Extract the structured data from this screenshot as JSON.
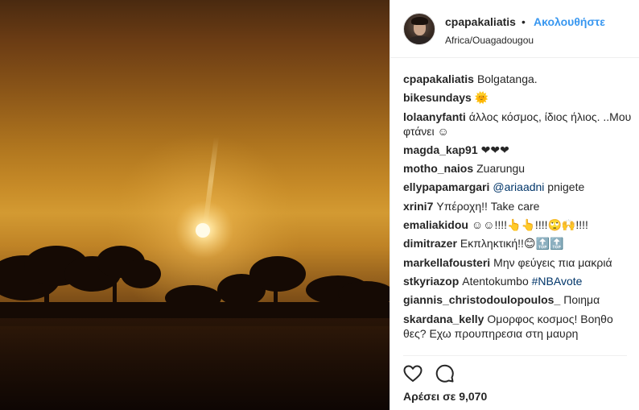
{
  "post": {
    "username": "cpapakaliatis",
    "separator": "•",
    "follow_label": "Ακολουθήστε",
    "location": "Africa/Ouagadougou"
  },
  "comments": [
    {
      "user": "cpapakaliatis",
      "text": "Bolgatanga."
    },
    {
      "user": "bikesundays",
      "text": "🌞"
    },
    {
      "user": "lolaanyfanti",
      "text": "άλλος κόσμος, ίδιος ήλιος. ..Μου φτάνει ☺"
    },
    {
      "user": "magda_kap91",
      "text": "❤❤❤"
    },
    {
      "user": "motho_naios",
      "text": "Zuarungu"
    },
    {
      "user": "ellypapamargari",
      "text": "",
      "mention": "@ariaadni",
      "after": " pnigete"
    },
    {
      "user": "xrini7",
      "text": "Υπέροχη!! Take care"
    },
    {
      "user": "emaliakidou",
      "text": "☺☺!!!!👆👆!!!!🙄🙌!!!!"
    },
    {
      "user": "dimitrazer",
      "text": "Εκπληκτική!!😊🔝🔝"
    },
    {
      "user": "markellafousteri",
      "text": "Μην φεύγεις πια μακριά"
    },
    {
      "user": "stkyriazop",
      "text": "Atentokumbo ",
      "mention": "#NBAvote",
      "after": ""
    },
    {
      "user": "giannis_christodoulopoulos_",
      "text": "Ποιημα"
    },
    {
      "user": "skardana_kelly",
      "text": "Ομορφος κοσμος! Βοηθο θες? Εχω προυπηρεσια στη μαυρη"
    }
  ],
  "footer": {
    "likes_label": "Αρέσει σε 9,070"
  },
  "icons": {
    "like": "heart-icon",
    "comment": "comment-bubble-icon"
  },
  "colors": {
    "follow": "#3897f0",
    "hashtag": "#003569",
    "text": "#262626"
  }
}
